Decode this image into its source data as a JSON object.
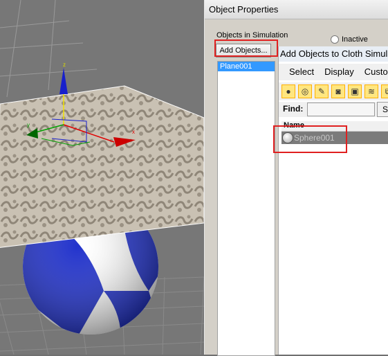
{
  "object_properties": {
    "title": "Object Properties",
    "objects_in_simulation_label": "Objects in Simulation",
    "inactive_label": "Inactive",
    "add_objects_button": "Add Objects...",
    "simulation_list": [
      "Plane001"
    ]
  },
  "add_objects_window": {
    "title": "Add Objects to Cloth Simulation",
    "menu": [
      "Select",
      "Display",
      "Customize"
    ],
    "toolbar_icons": [
      "geometry-icon",
      "shapes-icon",
      "lights-icon",
      "cameras-icon",
      "helpers-icon",
      "space-warps-icon",
      "groups-icon"
    ],
    "find_label": "Find:",
    "find_value": "",
    "select_button": "Select",
    "column_name": "Name",
    "objects": [
      "Sphere001"
    ]
  },
  "viewport": {
    "axis_labels": {
      "x": "x",
      "y": "y",
      "z": "z"
    }
  },
  "colors": {
    "highlight_red": "#e02020",
    "selection_blue": "#3399ff",
    "viewport_bg": "#777777"
  }
}
